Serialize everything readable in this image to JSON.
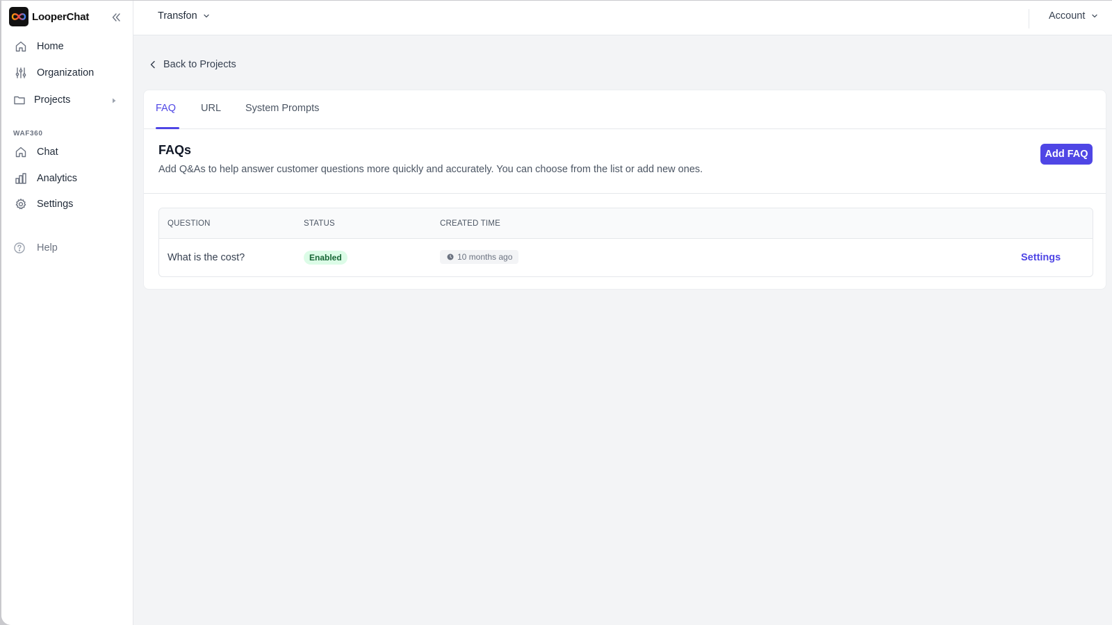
{
  "brand": {
    "name": "LooperChat"
  },
  "sidebar": {
    "items": [
      {
        "label": "Home",
        "icon": "home-icon"
      },
      {
        "label": "Organization",
        "icon": "sliders-icon"
      },
      {
        "label": "Projects",
        "icon": "folder-icon"
      }
    ],
    "section_label": "WAF360",
    "project_items": [
      {
        "label": "Chat",
        "icon": "home-icon"
      },
      {
        "label": "Analytics",
        "icon": "bar-chart-icon"
      },
      {
        "label": "Settings",
        "icon": "gear-icon"
      }
    ],
    "help_label": "Help"
  },
  "topbar": {
    "project": "Transfon",
    "account": "Account"
  },
  "main": {
    "back_label": "Back to Projects",
    "tabs": [
      {
        "label": "FAQ",
        "active": true
      },
      {
        "label": "URL",
        "active": false
      },
      {
        "label": "System Prompts",
        "active": false
      }
    ],
    "title": "FAQs",
    "description": "Add Q&As to help answer customer questions more quickly and accurately. You can choose from the list or add new ones.",
    "add_button": "Add FAQ",
    "table": {
      "columns": [
        "QUESTION",
        "STATUS",
        "CREATED TIME"
      ],
      "rows": [
        {
          "question": "What is the cost?",
          "status": "Enabled",
          "created": "10 months ago",
          "action": "Settings"
        }
      ]
    }
  },
  "colors": {
    "accent": "#4f46e5",
    "status_enabled_bg": "#dcfce7",
    "status_enabled_text": "#166534"
  }
}
